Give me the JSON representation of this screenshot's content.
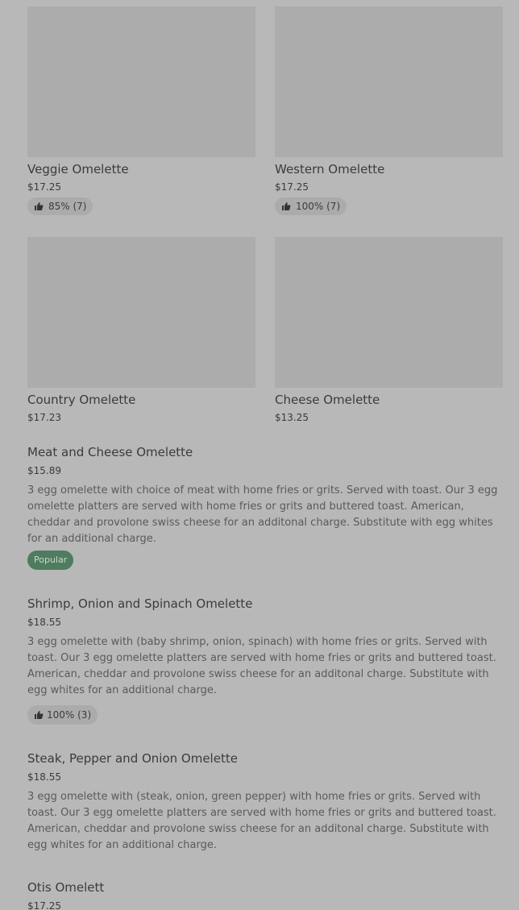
{
  "grid": [
    {
      "name": "Veggie Omelette",
      "price": "$17.25",
      "rating": "85% (7)"
    },
    {
      "name": "Western Omelette",
      "price": "$17.25",
      "rating": "100% (7)"
    },
    {
      "name": "Country Omelette",
      "price": "$17.23"
    },
    {
      "name": "Cheese Omelette",
      "price": "$13.25"
    }
  ],
  "items": [
    {
      "name": "Meat and Cheese Omelette",
      "price": "$15.89",
      "description": "3 egg omelette with choice of meat with home fries or grits. Served with toast. Our 3 egg omelette platters are served with home fries or grits and buttered toast. American, cheddar and provolone swiss cheese for an additonal charge. Substitute with egg whites for an additional charge.",
      "badge": "Popular"
    },
    {
      "name": "Shrimp, Onion and Spinach Omelette",
      "price": "$18.55",
      "description": "3 egg omelette with (baby shrimp, onion, spinach) with home fries or grits. Served with toast. Our 3 egg omelette platters are served with home fries or grits and buttered toast. American, cheddar and provolone swiss cheese for an additonal charge. Substitute with egg whites for an additional charge.",
      "rating": "100% (3)"
    },
    {
      "name": "Steak, Pepper and Onion Omelette",
      "price": "$18.55",
      "description": "3 egg omelette with (steak, onion, green pepper) with home fries or grits. Served with toast. Our 3 egg omelette platters are served with home fries or grits and buttered toast. American, cheddar and provolone swiss cheese for an additonal charge. Substitute with egg whites for an additional charge."
    },
    {
      "name": "Otis Omelett",
      "price": "$17.25"
    }
  ],
  "icons": {
    "rating": "thumbs-up-icon"
  },
  "colors": {
    "background": "#b8b8b8",
    "badge": "#4f7c5f"
  }
}
